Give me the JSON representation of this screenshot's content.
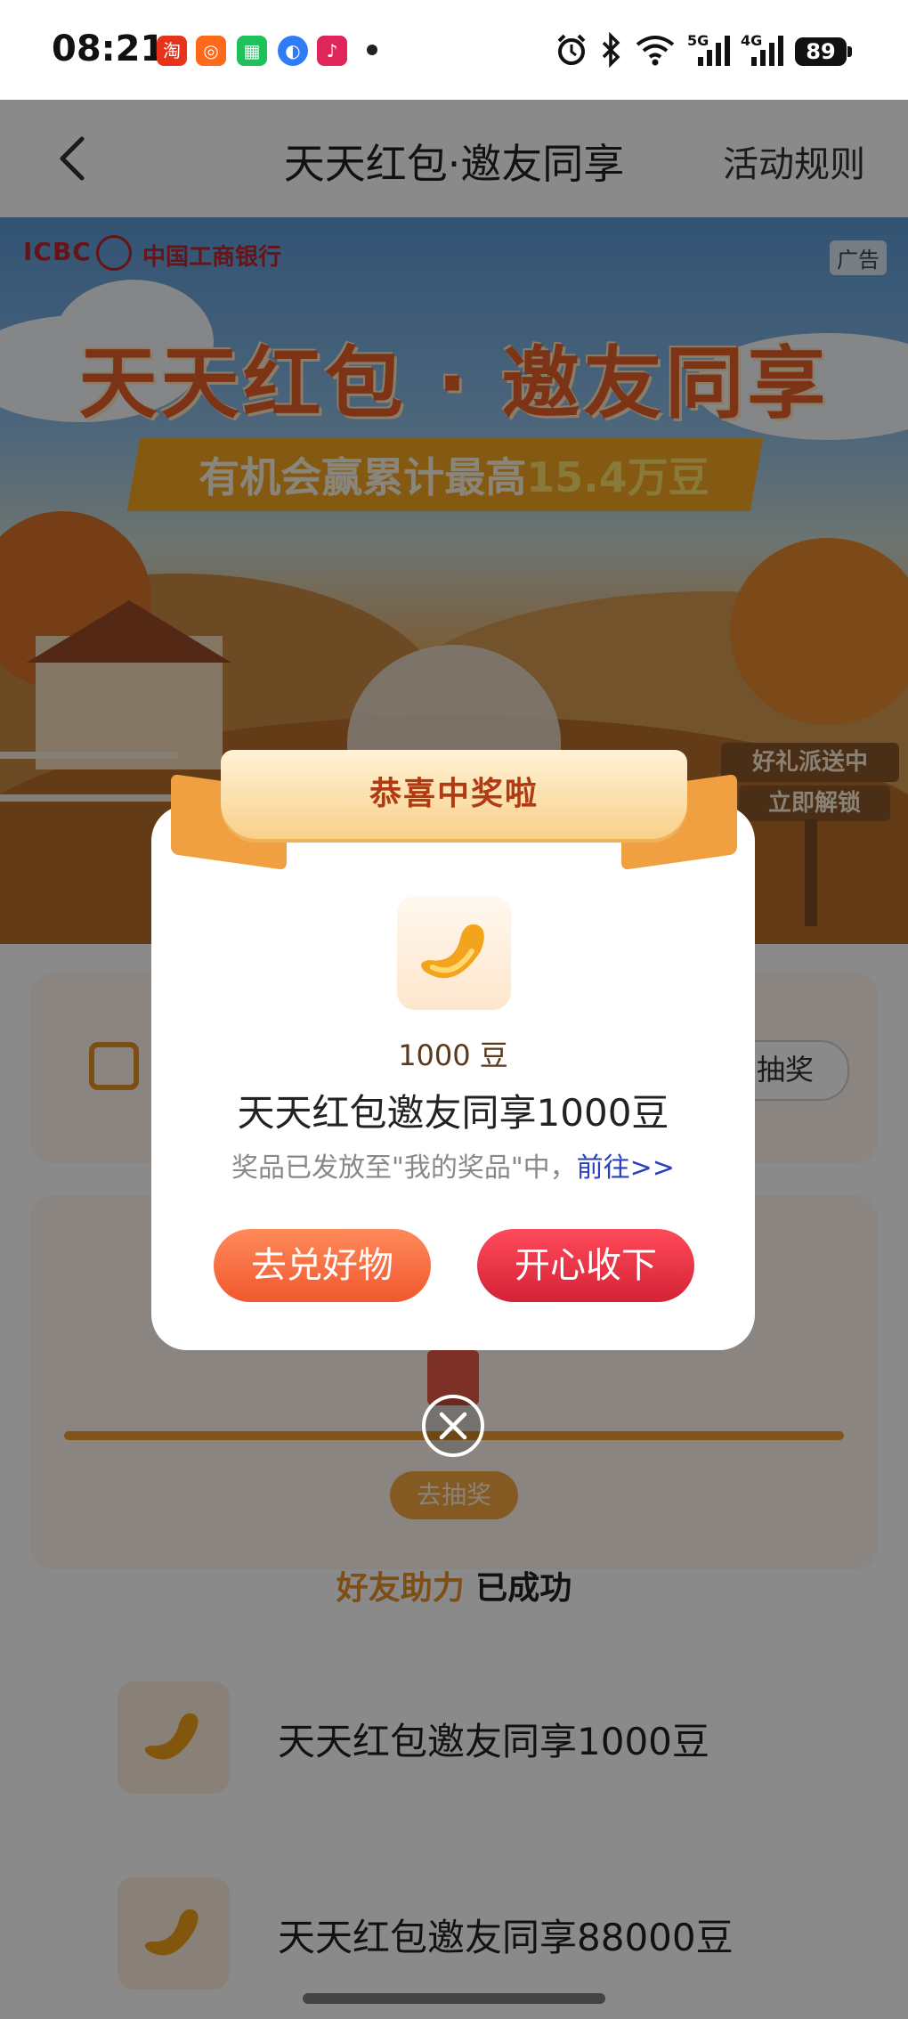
{
  "status_bar": {
    "time": "08:21",
    "battery": "89",
    "network_5g": "5G",
    "network_4g": "4G",
    "icons": [
      "taobao-app-icon",
      "kuaishou-app-icon",
      "mini-program-icon",
      "browser-app-icon",
      "douyin-app-icon",
      "alarm-icon",
      "bluetooth-icon",
      "wifi-icon",
      "signal-5g-icon",
      "signal-4g-icon"
    ]
  },
  "header": {
    "title": "天天红包·邀友同享",
    "rules": "活动规则"
  },
  "banner": {
    "bank_en": "ICBC",
    "bank_cn": "中国工商银行",
    "ad_tag": "广告",
    "title": "天天红包 · 邀友同享",
    "subtitle_prefix": "有机会赢累计最高",
    "subtitle_highlight": "15.4万豆",
    "sign_top": "好礼派送中",
    "sign_bottom": "立即解锁"
  },
  "background": {
    "lottery_chip": "抽奖",
    "lottery_button": "去抽奖",
    "assist_title_hl": "好友助力",
    "assist_title_rest": " 已成功",
    "prize_rows": [
      {
        "label": "天天红包邀友同享1000豆"
      },
      {
        "label": "天天红包邀友同享88000豆"
      }
    ]
  },
  "modal": {
    "ribbon": "恭喜中奖啦",
    "prize_amount": "1000 豆",
    "prize_name": "天天红包邀友同享1000豆",
    "note_prefix": "奖品已发放至\"我的奖品\"中，",
    "note_link": "前往>>",
    "btn_redeem": "去兑好物",
    "btn_accept": "开心收下"
  },
  "colors": {
    "accent_orange": "#f0582e",
    "accent_red": "#d42236",
    "link_blue": "#2a3fc0",
    "ribbon_text": "#b23a12"
  }
}
